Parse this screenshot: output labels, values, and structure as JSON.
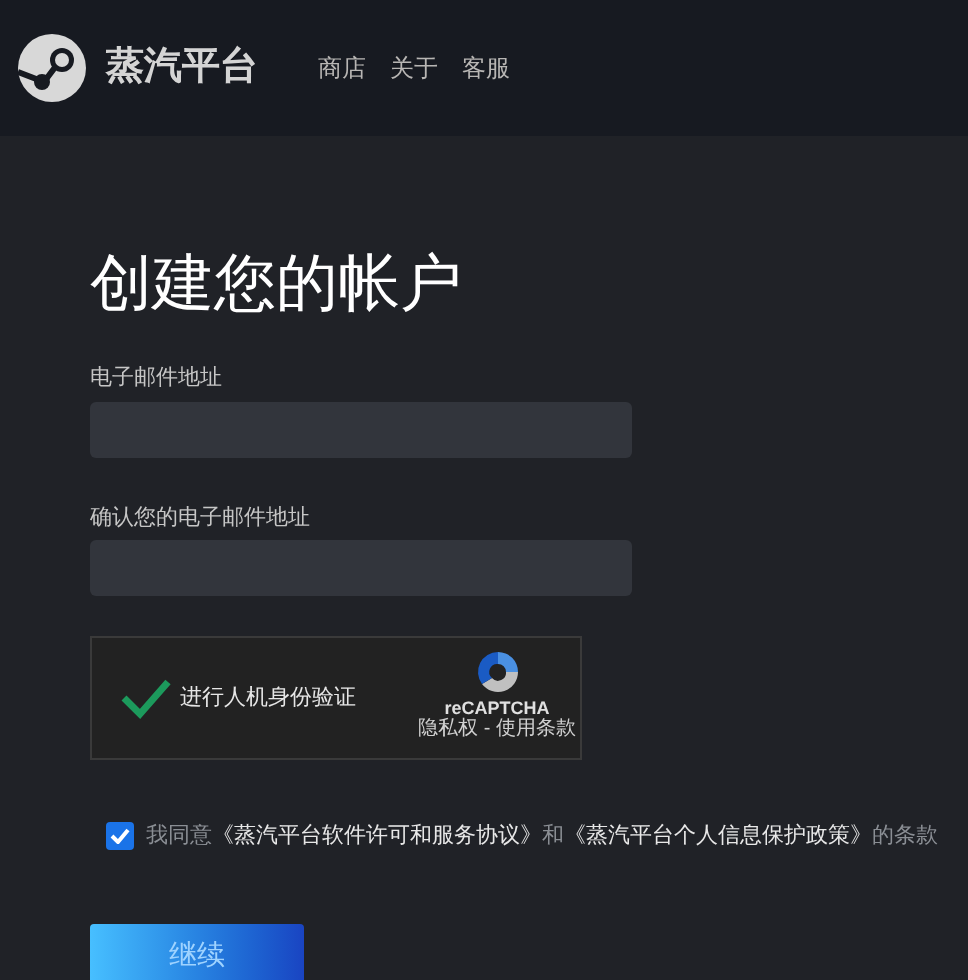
{
  "header": {
    "brand": "蒸汽平台",
    "nav": [
      {
        "label": "商店"
      },
      {
        "label": "关于"
      },
      {
        "label": "客服"
      }
    ]
  },
  "form": {
    "title": "创建您的帐户",
    "fields": [
      {
        "label": "电子邮件地址"
      },
      {
        "label": "确认您的电子邮件地址"
      }
    ],
    "captcha": {
      "checked": true,
      "label": "进行人机身份验证",
      "brand": "reCAPTCHA",
      "links": "隐私权 - 使用条款"
    },
    "agreement": {
      "checked": true,
      "parts": [
        {
          "kind": "text",
          "text": "我同意"
        },
        {
          "kind": "link",
          "text": "《蒸汽平台软件许可和服务协议》"
        },
        {
          "kind": "text",
          "text": "和"
        },
        {
          "kind": "link",
          "text": "《蒸汽平台个人信息保护政策》"
        },
        {
          "kind": "text",
          "text": "的条款"
        }
      ]
    },
    "submit": "继续"
  }
}
